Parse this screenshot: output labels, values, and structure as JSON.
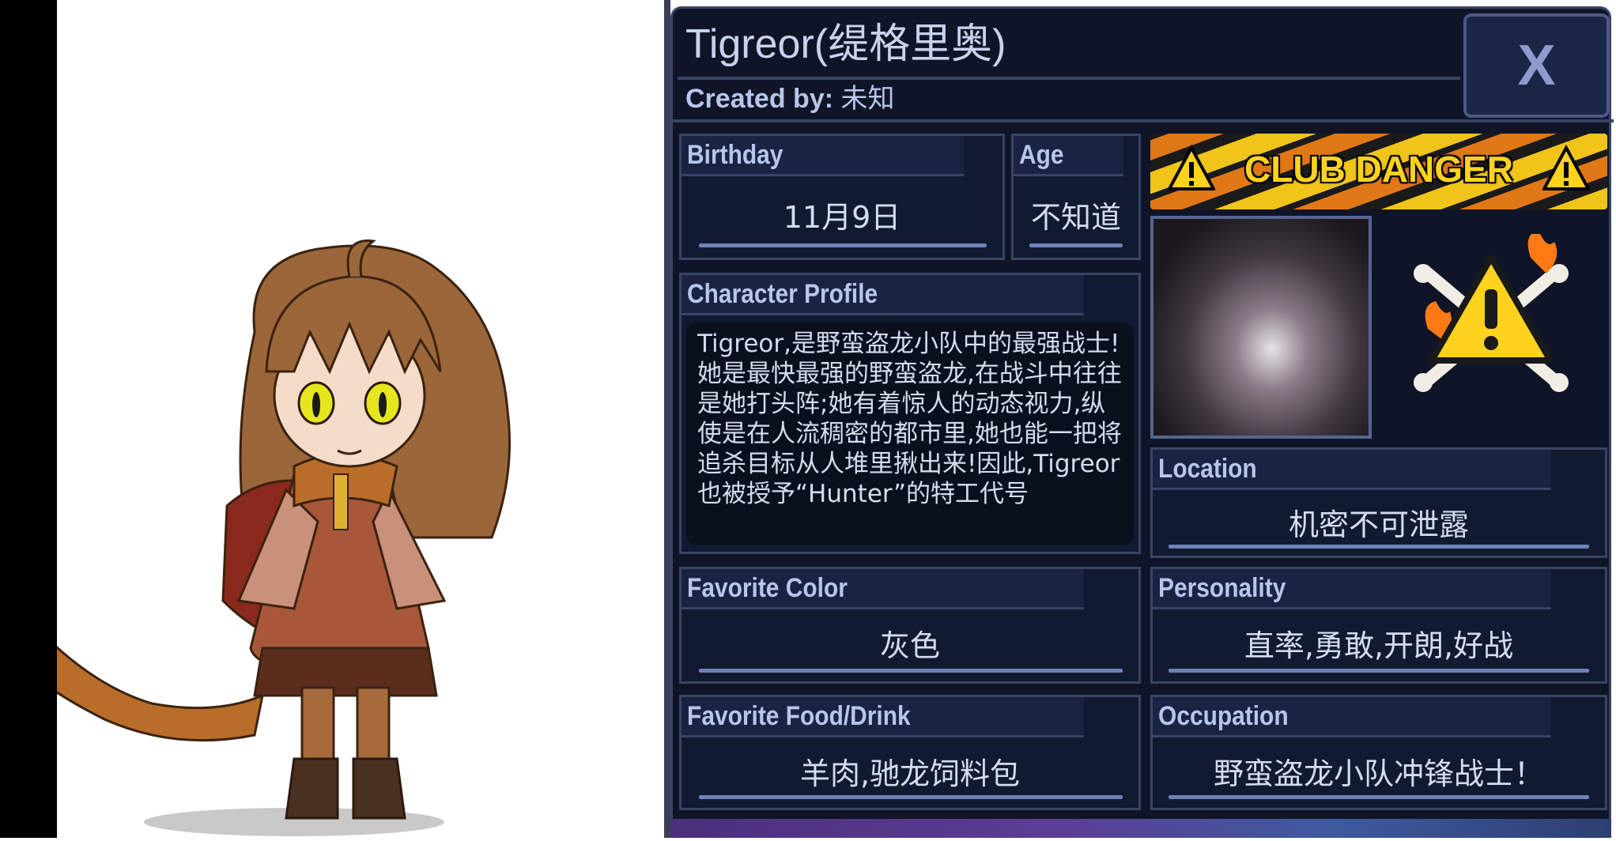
{
  "character": {
    "name": "Tigreor(缇格里奥)",
    "created_by_label": "Created by:",
    "created_by_value": "未知"
  },
  "close_label": "X",
  "fields": {
    "birthday": {
      "label": "Birthday",
      "value": "11月9日"
    },
    "age": {
      "label": "Age",
      "value": "不知道"
    },
    "profile": {
      "label": "Character Profile",
      "text": "Tigreor,是野蛮盗龙小队中的最强战士!她是最快最强的野蛮盗龙,在战斗中往往是她打头阵;她有着惊人的动态视力,纵使是在人流稠密的都市里,她也能一把将追杀目标从人堆里揪出来!因此,Tigreor也被授予“Hunter”的特工代号"
    },
    "location": {
      "label": "Location",
      "value": "机密不可泄露"
    },
    "favorite_color": {
      "label": "Favorite Color",
      "value": "灰色"
    },
    "personality": {
      "label": "Personality",
      "value": "直率,勇敢,开朗,好战"
    },
    "favorite_food": {
      "label": "Favorite Food/Drink",
      "value": "羊肉,驰龙饲料包"
    },
    "occupation": {
      "label": "Occupation",
      "value": "野蛮盗龙小队冲锋战士！"
    }
  },
  "badge": {
    "text": "CLUB DANGER",
    "icon": "danger-warning-icon"
  },
  "colors": {
    "panel_bg": "#0f1526",
    "label_text": "#b8c6ec",
    "value_text": "#d6dcef",
    "underline": "#6f82b8"
  }
}
